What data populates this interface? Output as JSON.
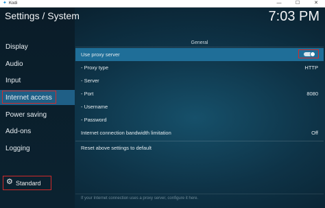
{
  "window": {
    "title": "Kodi",
    "min_glyph": "—",
    "max_glyph": "☐",
    "close_glyph": "✕"
  },
  "header": {
    "title": "Settings / System",
    "clock": "7:03 PM"
  },
  "sidebar": {
    "items": [
      {
        "label": "Display"
      },
      {
        "label": "Audio"
      },
      {
        "label": "Input"
      },
      {
        "label": "Internet access"
      },
      {
        "label": "Power saving"
      },
      {
        "label": "Add-ons"
      },
      {
        "label": "Logging"
      }
    ],
    "active_index": 3,
    "level_button": "Standard"
  },
  "main": {
    "section": "General",
    "rows": [
      {
        "label": "Use proxy server",
        "value": ""
      },
      {
        "label": "- Proxy type",
        "value": "HTTP"
      },
      {
        "label": "- Server",
        "value": ""
      },
      {
        "label": "- Port",
        "value": "8080"
      },
      {
        "label": "- Username",
        "value": ""
      },
      {
        "label": "- Password",
        "value": ""
      },
      {
        "label": "Internet connection bandwidth limitation",
        "value": "Off"
      },
      {
        "label": "Reset above settings to default",
        "value": ""
      }
    ],
    "proxy_enabled": true,
    "help_text": "If your Internet connection uses a proxy server, configure it here."
  },
  "colors": {
    "accent": "#1f6e98",
    "highlight_border": "#d32a2a"
  }
}
